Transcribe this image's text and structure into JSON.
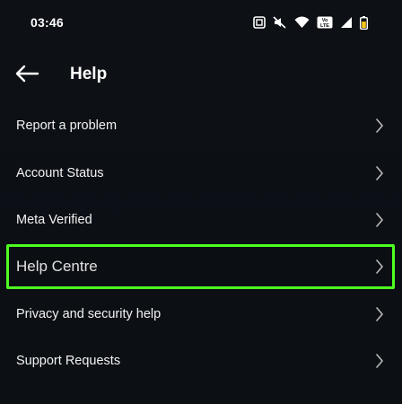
{
  "status_bar": {
    "time": "03:46",
    "icons": [
      "nfc-icon",
      "mute-icon",
      "wifi-icon",
      "volte-icon",
      "signal-icon",
      "battery-icon"
    ],
    "volte_text": "Vo LTE"
  },
  "header": {
    "title": "Help",
    "back_icon": "arrow-left-icon"
  },
  "menu": {
    "items": [
      {
        "label": "Report a problem"
      },
      {
        "label": "Account Status"
      },
      {
        "label": "Meta Verified"
      },
      {
        "label": "Help Centre",
        "highlighted": true
      },
      {
        "label": "Privacy and security help"
      },
      {
        "label": "Support Requests"
      }
    ],
    "chevron_icon": "chevron-right-icon"
  },
  "colors": {
    "background": "#0c1014",
    "text": "#f2f2f2",
    "highlight": "#4dff21",
    "chevron": "#b9b9b9"
  }
}
